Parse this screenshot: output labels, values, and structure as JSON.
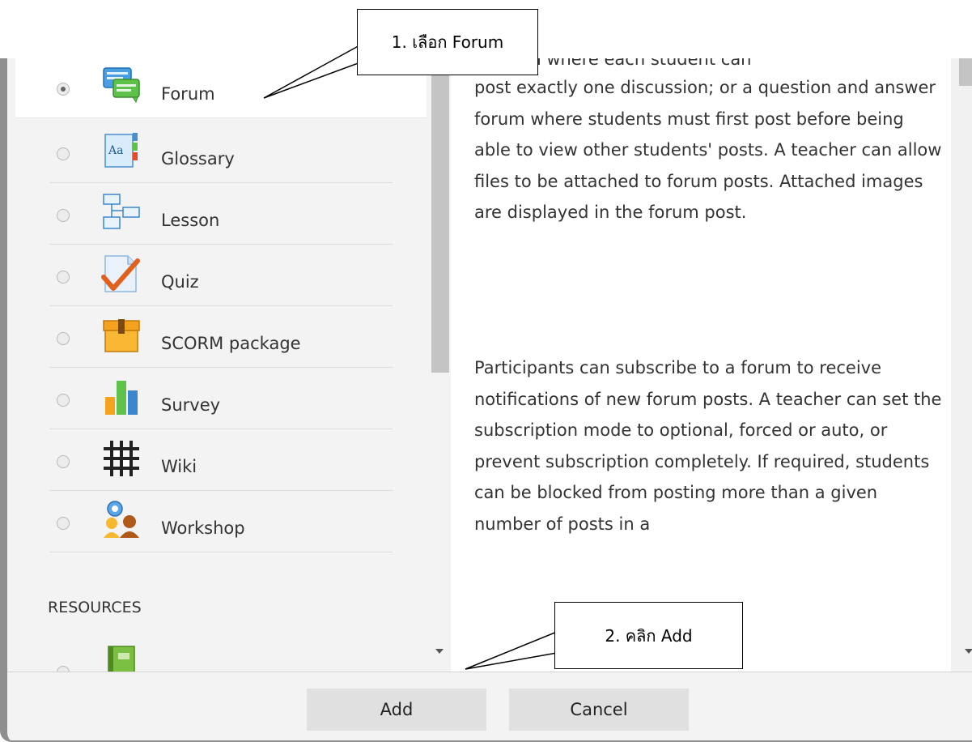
{
  "activities": [
    {
      "label": "Forum",
      "icon": "forum-icon",
      "selected": true
    },
    {
      "label": "Glossary",
      "icon": "glossary-icon",
      "selected": false
    },
    {
      "label": "Lesson",
      "icon": "lesson-icon",
      "selected": false
    },
    {
      "label": "Quiz",
      "icon": "quiz-icon",
      "selected": false
    },
    {
      "label": "SCORM package",
      "icon": "scorm-package-icon",
      "selected": false
    },
    {
      "label": "Survey",
      "icon": "survey-icon",
      "selected": false
    },
    {
      "label": "Wiki",
      "icon": "wiki-icon",
      "selected": false
    },
    {
      "label": "Workshop",
      "icon": "workshop-icon",
      "selected": false
    }
  ],
  "resources_section": {
    "title": "RESOURCES",
    "first_item_icon": "book-icon"
  },
  "description": {
    "partial_first_line": "d forum where each student can",
    "paragraph1": "post exactly one discussion; or a question and answer forum where students must first post before being able to view other students' posts. A teacher can allow files to be attached to forum posts. Attached images are displayed in the forum post.",
    "paragraph2": "Participants can subscribe to a forum to receive notifications of new forum posts. A teacher can set the subscription mode to optional, forced or auto, or prevent subscription completely. If required, students can be blocked from posting more than a given number of posts in a"
  },
  "buttons": {
    "add_label": "Add",
    "cancel_label": "Cancel"
  },
  "callouts": {
    "step1": "1. เลือก Forum",
    "step2": "2. คลิก Add"
  },
  "colors": {
    "pane_bg": "#f3f3f3",
    "button_bg": "#e0e0e0",
    "frame": "#8f8f8f"
  }
}
